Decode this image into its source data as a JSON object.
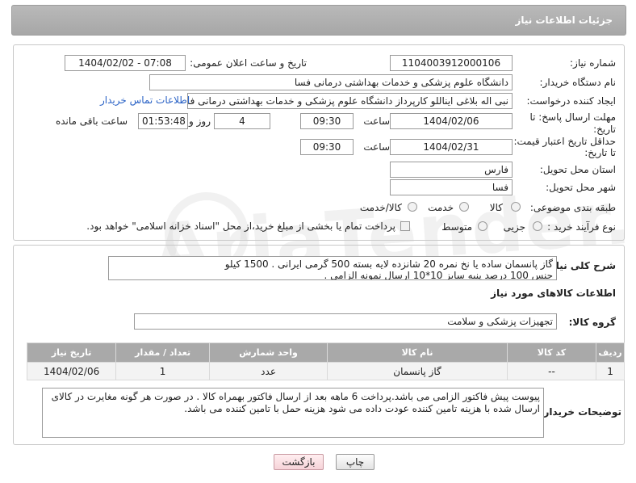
{
  "header": {
    "title": "جزئیات اطلاعات نیاز"
  },
  "form": {
    "need_number_label": "شماره نیاز:",
    "need_number": "1104003912000106",
    "announce_label": "تاریخ و ساعت اعلان عمومی:",
    "announce_value": "1404/02/02 - 07:08",
    "buyer_org_label": "نام دستگاه خریدار:",
    "buyer_org": "دانشگاه علوم پزشکی و خدمات بهداشتی درمانی فسا",
    "requester_label": "ایجاد کننده درخواست:",
    "requester": "نبی اله بلاغی ایناللو کارپرداز دانشگاه علوم پزشکی و خدمات بهداشتی درمانی فسا",
    "contact_link": "اطلاعات تماس خریدار",
    "deadline_label_1": "مهلت ارسال پاسخ: تا",
    "deadline_label_2": "تاریخ:",
    "deadline_date": "1404/02/06",
    "time_label": "ساعت",
    "deadline_time": "09:30",
    "days_value": "4",
    "days_label": "روز و",
    "remaining_time": "01:53:48",
    "remaining_label": "ساعت باقی مانده",
    "min_validity_label_1": "حداقل تاریخ اعتبار قیمت:",
    "min_validity_label_2": "تا تاریخ:",
    "validity_date": "1404/02/31",
    "validity_time": "09:30",
    "province_label": "استان محل تحویل:",
    "province": "فارس",
    "city_label": "شهر محل تحویل:",
    "city": "فسا",
    "category_label": "طبقه بندی موضوعی:",
    "category_options": [
      "کالا",
      "خدمت",
      "کالا/خدمت"
    ],
    "purchase_type_label": "نوع فرآیند خرید :",
    "purchase_options": [
      "جزیی",
      "متوسط"
    ],
    "payment_note": "پرداخت تمام یا بخشی از مبلغ خرید،از محل \"اسناد خزانه اسلامی\" خواهد بود."
  },
  "description": {
    "label": "شرح کلی نیاز:",
    "line1": "گاز پانسمان ساده یا نخ نمره 20 شانزده لایه بسته 500 گرمی ایرانی . 1500 کیلو",
    "line2": "جنس 100 درصد پنبه سایز 10*10 ارسال نمونه الزامی ."
  },
  "goods": {
    "section_title": "اطلاعات کالاهای مورد نیاز",
    "group_label": "گروه کالا:",
    "group_value": "تجهیزات پزشکی و سلامت",
    "columns": [
      "ردیف",
      "کد کالا",
      "نام کالا",
      "واحد شمارش",
      "تعداد / مقدار",
      "تاریخ نیاز"
    ],
    "rows": [
      {
        "row": "1",
        "code": "--",
        "name": "گاز پانسمان",
        "unit": "عدد",
        "qty": "1",
        "date": "1404/02/06"
      }
    ]
  },
  "buyer_notes": {
    "label": "توضیحات خریدار:",
    "line1": "پیوست پیش فاکتور الزامی می باشد.پرداخت 6 ماهه بعد از ارسال فاکتور بهمراه کالا . در صورت هر گونه مغایرت در کالای",
    "line2": "ارسال شده با هزینه تامین کننده  عودت داده می شود  هزینه حمل با تامین  کننده می باشد."
  },
  "buttons": {
    "print": "چاپ",
    "back": "بازگشت"
  },
  "watermark_text": "AriaTender.net"
}
